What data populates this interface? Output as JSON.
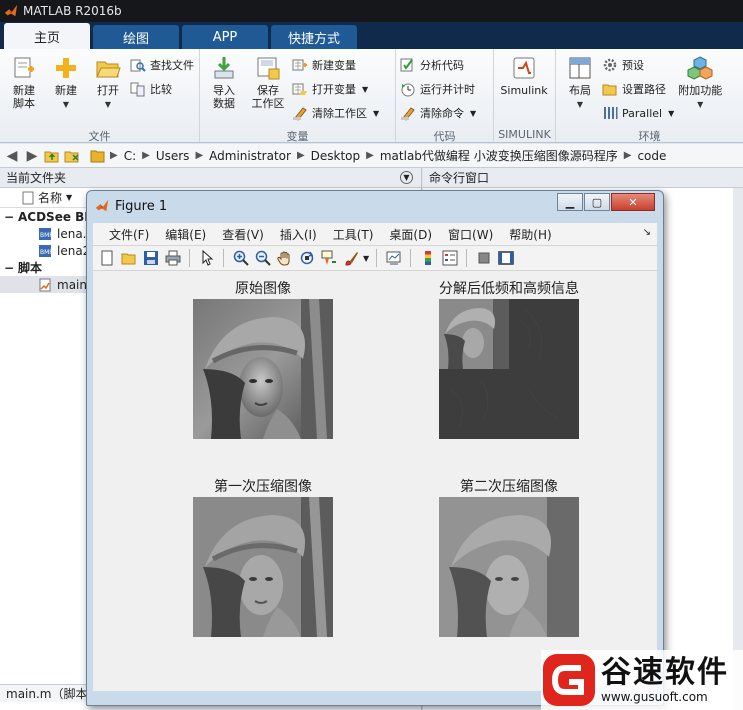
{
  "app": {
    "title": "MATLAB R2016b"
  },
  "tabs": [
    {
      "label": "主页",
      "active": true
    },
    {
      "label": "绘图",
      "active": false
    },
    {
      "label": "APP",
      "active": false
    },
    {
      "label": "快捷方式",
      "active": false
    }
  ],
  "ribbon": {
    "file": {
      "label": "文件",
      "new_script": "新建\n脚本",
      "new": "新建",
      "open": "打开",
      "find_files": "查找文件",
      "compare": "比较"
    },
    "variable": {
      "label": "变量",
      "import_data": "导入\n数据",
      "save_workspace": "保存\n工作区",
      "new_variable": "新建变量",
      "open_variable": "打开变量",
      "clear_workspace": "清除工作区"
    },
    "code": {
      "label": "代码",
      "analyze_code": "分析代码",
      "run_and_time": "运行并计时",
      "clear_commands": "清除命令"
    },
    "simulink": {
      "label": "SIMULINK",
      "simulink": "Simulink"
    },
    "environment": {
      "label": "环境",
      "layout": "布局",
      "preferences": "预设",
      "set_path": "设置路径",
      "parallel": "Parallel",
      "add_ons": "附加功能"
    }
  },
  "address": {
    "path": [
      "C:",
      "Users",
      "Administrator",
      "Desktop",
      "matlab代做编程 小波变换压缩图像源码程序",
      "code"
    ]
  },
  "current_folder": {
    "title": "当前文件夹",
    "name_col": "名称",
    "groups": [
      {
        "label": "ACDSee BM",
        "files": [
          "lena.b",
          "lena2"
        ]
      },
      {
        "label": "脚本",
        "files": [
          "main."
        ]
      }
    ],
    "status": "main.m（脚本"
  },
  "command_window": {
    "title": "命令行窗口"
  },
  "figure": {
    "title": "Figure 1",
    "menu": [
      "文件(F)",
      "编辑(E)",
      "查看(V)",
      "插入(I)",
      "工具(T)",
      "桌面(D)",
      "窗口(W)",
      "帮助(H)"
    ],
    "toolbar": [
      "new-figure",
      "open-file",
      "save",
      "print",
      "select",
      "zoom-in",
      "zoom-out",
      "pan",
      "rotate-3d",
      "data-cursor",
      "brush",
      "link-plot",
      "colorbar",
      "legend",
      "hide-plot-tools",
      "show-plot-tools"
    ],
    "subplots": [
      {
        "title": "原始图像",
        "variant": "original"
      },
      {
        "title": "分解后低频和高频信息",
        "variant": "decomposed"
      },
      {
        "title": "第一次压缩图像",
        "variant": "compressed1"
      },
      {
        "title": "第二次压缩图像",
        "variant": "compressed2"
      }
    ]
  },
  "watermark": {
    "name": "谷速软件",
    "url": "www.gusuoft.com"
  }
}
